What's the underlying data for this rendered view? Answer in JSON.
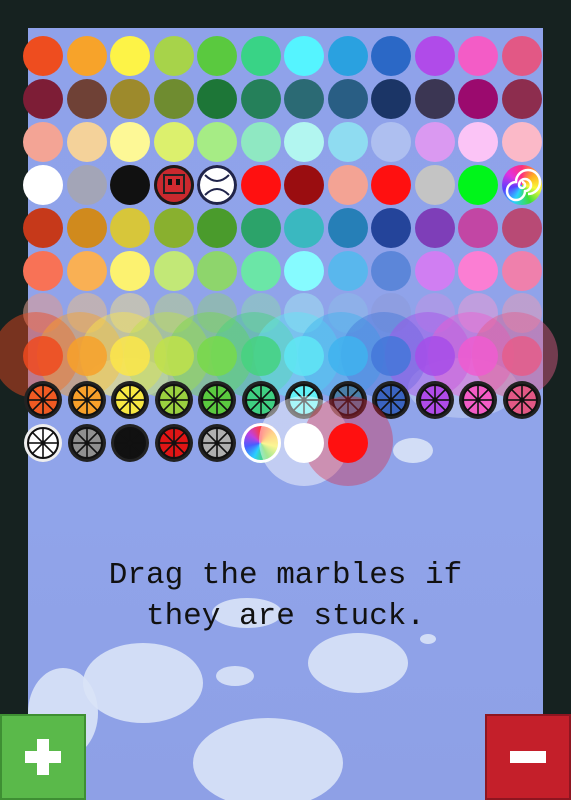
{
  "hint": {
    "line1": "Drag the marbles if",
    "line2": "they are stuck."
  },
  "buttons": {
    "add": {
      "icon": "plus-icon",
      "color": "#5ab94a"
    },
    "remove": {
      "icon": "minus-icon",
      "color": "#c41f2a"
    }
  },
  "palette": {
    "row1": [
      "#ee4d1f",
      "#f7a32a",
      "#fdf347",
      "#a7d34a",
      "#5ac93f",
      "#39d386",
      "#55f4ff",
      "#2aa1e0",
      "#2b68c6",
      "#b04be9",
      "#f35cc6",
      "#e25885"
    ],
    "row2": [
      "#7d1d36",
      "#6f4136",
      "#9d8a2c",
      "#6f8c30",
      "#1d7637",
      "#25805a",
      "#2b6a74",
      "#295e84",
      "#1b3566",
      "#3b3653",
      "#9b0a6e",
      "#8d2d4e"
    ],
    "row3": [
      "#f3a495",
      "#f4d29a",
      "#fdf896",
      "#dcf06d",
      "#a6ec85",
      "#8fe8c2",
      "#b2f6f0",
      "#8fdcf1",
      "#aebff0",
      "#da99f1",
      "#fbc4f6",
      "#fbb9c8"
    ],
    "row5": [
      "#c6391a",
      "#d08a1d",
      "#d7c63a",
      "#89b02f",
      "#4a9b2c",
      "#2ca36a",
      "#3ab8c0",
      "#267fb7",
      "#24449a",
      "#7e3eb8",
      "#c246a4",
      "#b84a75"
    ],
    "row6": [
      "#f87256",
      "#f9b054",
      "#fcf270",
      "#c2e877",
      "#8ed56c",
      "#6be6a7",
      "#86fbff",
      "#59b7ed",
      "#5c86d9",
      "#d07ef2",
      "#fb7ed3",
      "#ef80ac"
    ],
    "row7": [
      "#e09b8c",
      "#e6be8a",
      "#ead88e",
      "#b9d08a",
      "#8fc98a",
      "#8ed1b2",
      "#9ee0ee",
      "#8cbbe8",
      "#8c9bd8",
      "#c093e3",
      "#e79ad4",
      "#e19cb8"
    ],
    "splash": [
      "#f04a1f",
      "#f7a12a",
      "#fbe64a",
      "#bfe24a",
      "#78d94a",
      "#45d27f",
      "#5fe6f4",
      "#3fb3ee",
      "#4477d9",
      "#a64de9",
      "#ee5cd0",
      "#e55d8a"
    ],
    "wheel": [
      "#f05a22",
      "#f8a02a",
      "#f7e742",
      "#9ad03f",
      "#5ac93f",
      "#3fd082",
      "#62f0f5",
      "#4a7fa8",
      "#3a64c0",
      "#b04be9",
      "#f35cc6",
      "#e25885"
    ],
    "bottom": [
      "#ffffff",
      "#909090",
      "#111111",
      "#e01515",
      "#b0b0b0"
    ],
    "special": [
      "#ffffff",
      "#a3a5b7",
      "#111111",
      "#ff1010",
      "#9a0d10",
      "#f3a394",
      "#ff1010",
      "#c4c4c4",
      "#00f51a"
    ]
  }
}
